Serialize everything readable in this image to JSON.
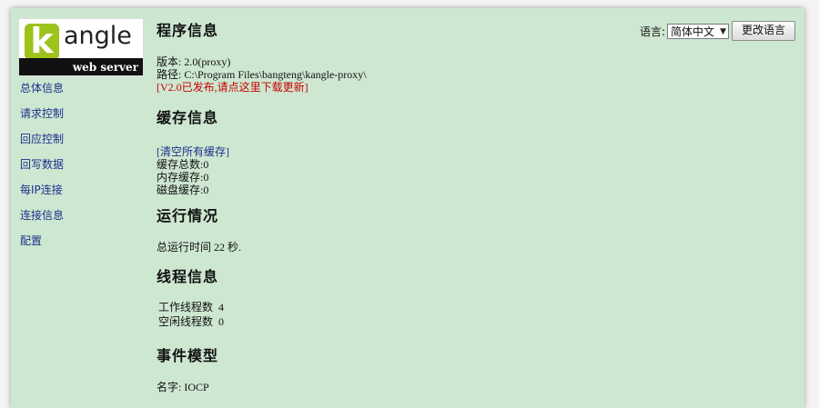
{
  "logo": {
    "letter": "k",
    "word": "angle",
    "tagline": "web server"
  },
  "sidebar": {
    "items": [
      {
        "label": "总体信息"
      },
      {
        "label": "请求控制"
      },
      {
        "label": "回应控制"
      },
      {
        "label": "回写数据"
      },
      {
        "label": "每IP连接"
      },
      {
        "label": "连接信息"
      },
      {
        "label": "配置"
      }
    ]
  },
  "language": {
    "label": "语言:",
    "selected": "简体中文",
    "button": "更改语言"
  },
  "program": {
    "title": "程序信息",
    "version": "版本: 2.0(proxy)",
    "path": "路径: C:\\Program Files\\bangteng\\kangle-proxy\\",
    "update_link": "[V2.0已发布,请点这里下载更新]"
  },
  "cache": {
    "title": "缓存信息",
    "clear_link": "[清空所有缓存]",
    "total": "缓存总数:0",
    "memory": "内存缓存:0",
    "disk": "磁盘缓存:0"
  },
  "runtime": {
    "title": "运行情况",
    "uptime": "总运行时间  22 秒."
  },
  "threads": {
    "title": "线程信息",
    "rows": [
      {
        "label": "工作线程数",
        "value": "4"
      },
      {
        "label": "空闲线程数",
        "value": "0"
      }
    ]
  },
  "event_model": {
    "title": "事件模型",
    "name": "名字: IOCP"
  }
}
